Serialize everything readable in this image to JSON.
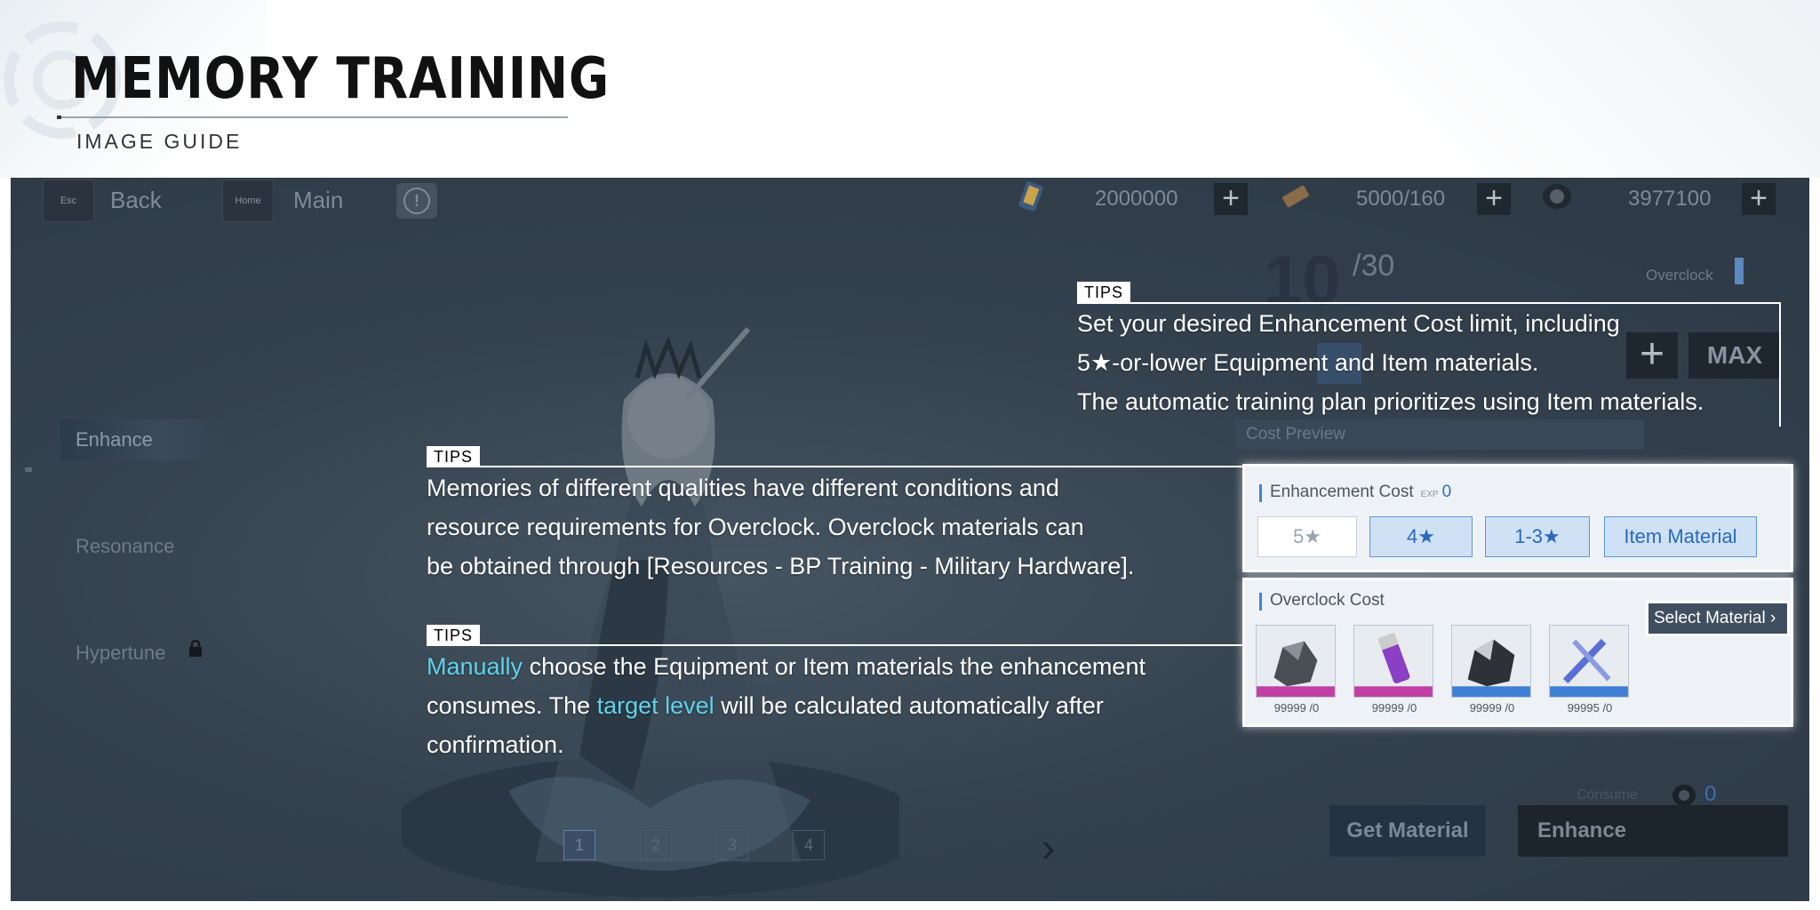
{
  "header": {
    "title": "MEMORY TRAINING",
    "subtitle": "IMAGE GUIDE"
  },
  "topbar": {
    "back_key": "Esc",
    "back_label": "Back",
    "home_key": "Home",
    "home_label": "Main",
    "resources": [
      {
        "icon": "ticket-icon",
        "value": "2000000"
      },
      {
        "icon": "battery-icon",
        "value": "5000/160"
      },
      {
        "icon": "coin-icon",
        "value": "3977100"
      }
    ]
  },
  "nav": {
    "items": [
      "Enhance",
      "Resonance",
      "Hypertune"
    ],
    "active": "Enhance"
  },
  "level": {
    "current": "10",
    "max": "/30",
    "overclock_label": "Overclock",
    "max_button": "MAX",
    "cost_preview": "Cost Preview",
    "select_material": "Select Material"
  },
  "enhancement_cost": {
    "title": "Enhancement Cost",
    "exp_label": "EXP",
    "exp_value": "0",
    "filters": [
      {
        "label": "5★",
        "selected": false
      },
      {
        "label": "4★",
        "selected": true
      },
      {
        "label": "1-3★",
        "selected": true
      },
      {
        "label": "Item Material",
        "selected": true
      }
    ]
  },
  "overclock_cost": {
    "title": "Overclock Cost",
    "materials": [
      {
        "icon": "ore-icon",
        "count": "99999 /0"
      },
      {
        "icon": "cylinder-icon",
        "count": "99999 /0"
      },
      {
        "icon": "crystal-icon",
        "count": "99999 /0"
      },
      {
        "icon": "wrench-icon",
        "count": "99995 /0"
      }
    ]
  },
  "footer": {
    "consume_label": "Consume",
    "consume_value": "0",
    "get_material": "Get Material",
    "enhance": "Enhance",
    "pages": [
      "1",
      "2",
      "3",
      "4"
    ],
    "active_page": "1"
  },
  "tips": {
    "tag": "TIPS",
    "tip1": [
      "Set your desired Enhancement Cost limit, including",
      "5★-or-lower Equipment and Item materials.",
      "The automatic training plan prioritizes using Item materials."
    ],
    "tip2": [
      "Memories of different qualities have different conditions and",
      "resource requirements for Overclock. Overclock materials can",
      "be obtained through [Resources - BP Training - Military Hardware]."
    ],
    "tip3": {
      "line1_highlight": "Manually",
      "line1_rest": " choose the Equipment or Item materials the enhancement",
      "line2_pre": "consumes. The ",
      "line2_highlight": "target level",
      "line2_post": " will be calculated automatically after",
      "line3": "confirmation."
    }
  },
  "colors": {
    "highlight": "#5fd2ea",
    "accent_blue": "#2a69bd",
    "screen_bg": "#3f4d5a"
  }
}
